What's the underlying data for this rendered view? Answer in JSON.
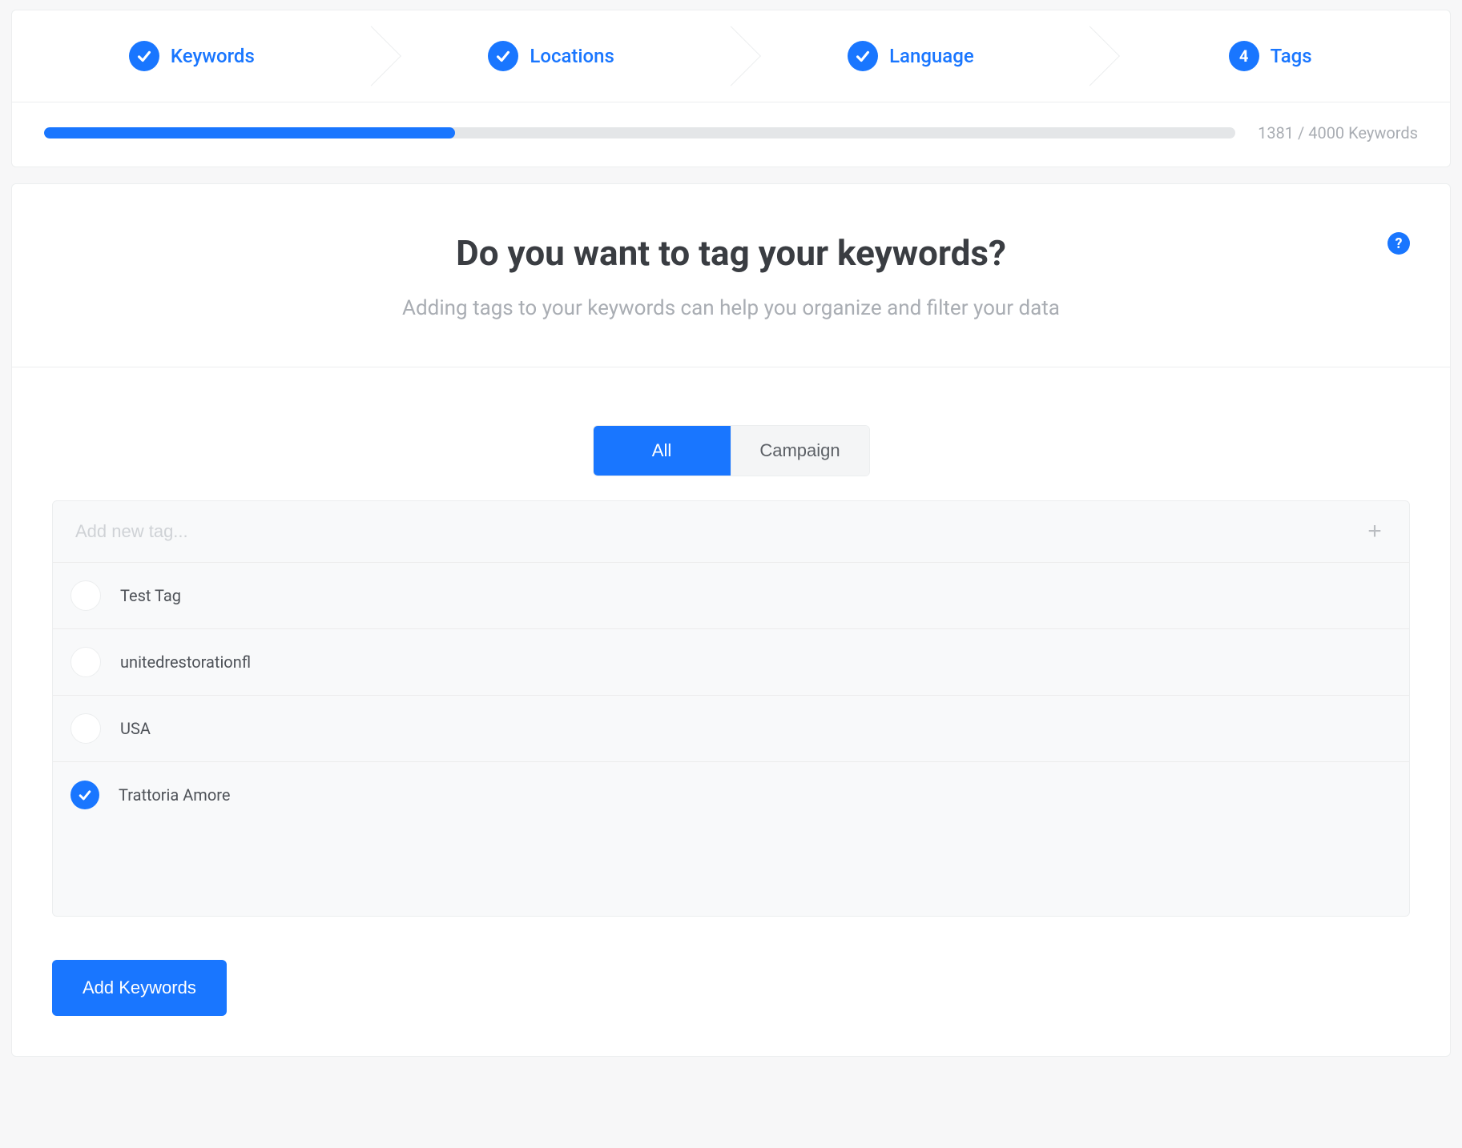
{
  "stepper": {
    "steps": [
      {
        "label": "Keywords",
        "state": "done"
      },
      {
        "label": "Locations",
        "state": "done"
      },
      {
        "label": "Language",
        "state": "done"
      },
      {
        "label": "Tags",
        "state": "current",
        "number": "4"
      }
    ]
  },
  "progress": {
    "current": 1381,
    "total": 4000,
    "label": "1381 / 4000 Keywords",
    "percent": 34.5
  },
  "main": {
    "title": "Do you want to tag your keywords?",
    "subtitle": "Adding tags to your keywords can help you organize and filter your data"
  },
  "tabs": {
    "items": [
      {
        "label": "All",
        "active": true
      },
      {
        "label": "Campaign",
        "active": false
      }
    ]
  },
  "tag_input": {
    "placeholder": "Add new tag..."
  },
  "tags": [
    {
      "label": "Test Tag",
      "checked": false
    },
    {
      "label": "unitedrestorationfl",
      "checked": false
    },
    {
      "label": "USA",
      "checked": false
    },
    {
      "label": "Trattoria Amore",
      "checked": true
    }
  ],
  "actions": {
    "submit": "Add Keywords"
  }
}
